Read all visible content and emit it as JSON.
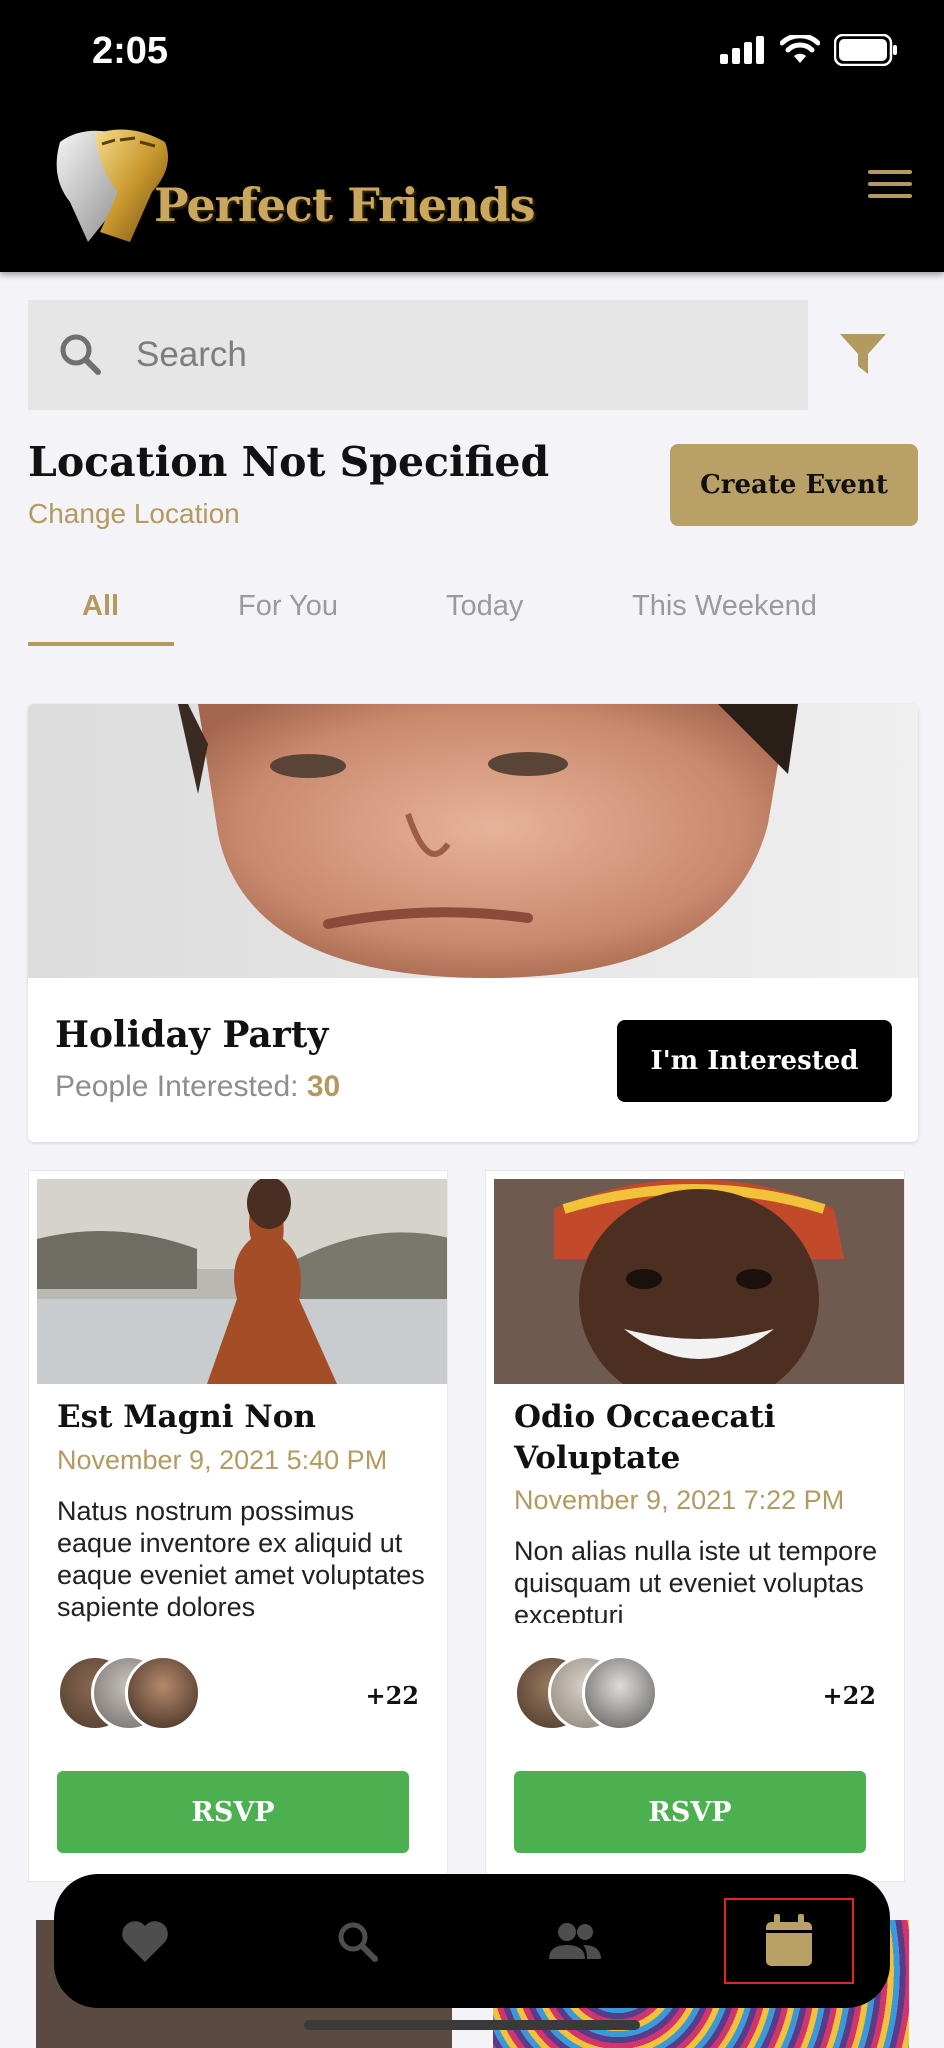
{
  "status_bar": {
    "time": "2:05"
  },
  "header": {
    "app_name": "Perfect Friends"
  },
  "search": {
    "placeholder": "Search"
  },
  "location": {
    "title": "Location Not Specified",
    "change_label": "Change Location"
  },
  "create_event_label": "Create Event",
  "tabs": [
    {
      "label": "All",
      "active": true
    },
    {
      "label": "For You",
      "active": false
    },
    {
      "label": "Today",
      "active": false
    },
    {
      "label": "This Weekend",
      "active": false
    }
  ],
  "featured": {
    "title": "Holiday Party",
    "people_label": "People Interested:",
    "people_count": "30",
    "button_label": "I'm Interested"
  },
  "events": [
    {
      "title": "Est Magni Non",
      "date": "November 9, 2021 5:40 PM",
      "description": "Natus nostrum possimus eaque inventore ex aliquid ut eaque eveniet amet voluptates sapiente dolores",
      "extra_count": "+22",
      "button_label": "RSVP"
    },
    {
      "title": "Odio Occaecati Voluptate",
      "date": "November 9, 2021 7:22 PM",
      "description": "Non alias nulla iste ut tempore quisquam ut eveniet voluptas excepturi",
      "extra_count": "+22",
      "button_label": "RSVP"
    }
  ],
  "bottom_nav": [
    {
      "icon": "heart-icon",
      "active": false
    },
    {
      "icon": "search-icon",
      "active": false
    },
    {
      "icon": "people-icon",
      "active": false
    },
    {
      "icon": "calendar-icon",
      "active": true
    }
  ],
  "colors": {
    "accent": "#b29a60",
    "rsvp": "#4caf50",
    "header": "#000000",
    "highlight": "#e0252a"
  }
}
